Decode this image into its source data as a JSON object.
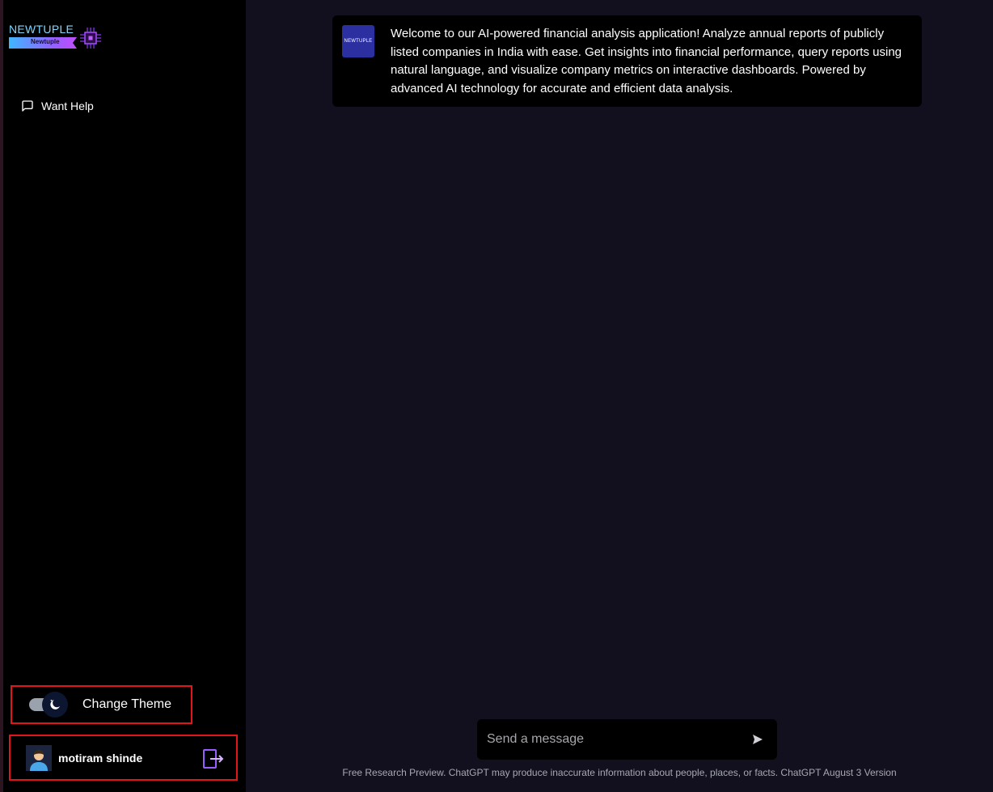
{
  "brand": {
    "name": "NEWTUPLE",
    "subname": "Newtuple"
  },
  "sidebar": {
    "items": [
      {
        "label": "Want Help",
        "icon": "message-square-icon"
      }
    ],
    "theme_toggle": {
      "label": "Change Theme",
      "state": "dark",
      "icon": "moon-icon"
    },
    "user": {
      "name": "motiram shinde",
      "logout_icon": "logout-icon"
    }
  },
  "chat": {
    "bot_avatar_label": "NEWTUPLE",
    "welcome_message": "Welcome to our AI-powered financial analysis application! Analyze annual reports of publicly listed companies in India with ease. Get insights into financial performance, query reports using natural language, and visualize company metrics on interactive dashboards. Powered by advanced AI technology for accurate and efficient data analysis."
  },
  "composer": {
    "placeholder": "Send a message",
    "send_icon": "send-icon"
  },
  "footer": {
    "note": "Free Research Preview. ChatGPT may produce inaccurate information about people, places, or facts. ChatGPT August 3 Version"
  },
  "colors": {
    "background": "#120f1e",
    "sidebar": "#000000",
    "highlight_border": "#e0161b",
    "bot_avatar": "#2b2fa0",
    "logout_accent": "#9b5cff"
  }
}
